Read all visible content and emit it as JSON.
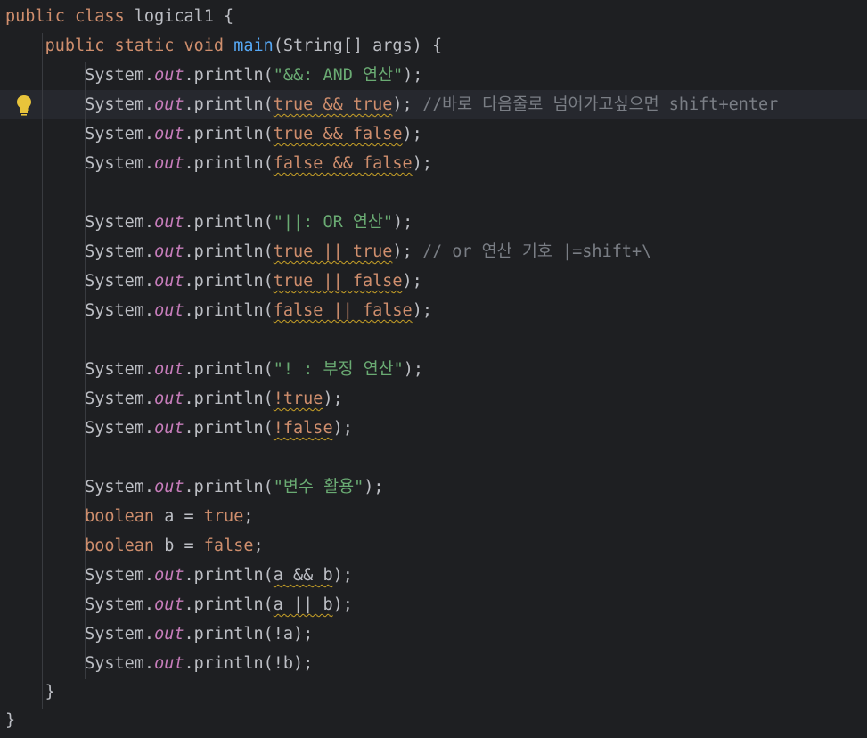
{
  "editor": {
    "theme": {
      "background": "#1e1f22",
      "current_line": "#26282e",
      "keyword": "#cf8e6d",
      "method_decl": "#56a8f5",
      "static_field": "#c77dbb",
      "string": "#6aab73",
      "comment": "#7a7e85",
      "default": "#bcbec4",
      "warning_underline": "#c9a227"
    },
    "code": {
      "class_decl": {
        "kw": "public class",
        "name": "logical1",
        "brace": "{"
      },
      "method_decl": {
        "kw": "public static void",
        "name": "main",
        "params": "(String[] args) {"
      },
      "sys": "System.",
      "out": "out",
      "println": ".println(",
      "close": ");",
      "kw_boolean": "boolean",
      "lines": {
        "s1": "\"&&: AND 연산\"",
        "t1": "true && true",
        "c1": "//바로 다음줄로 넘어가고싶으면 shift+enter",
        "t2": "true && false",
        "t3": "false && false",
        "s2": "\"||: OR 연산\"",
        "t4": "true || true",
        "c2": "// or 연산 기호 |=shift+\\",
        "t5": "true || false",
        "t6": "false || false",
        "s3": "\"! : 부정 연산\"",
        "t7": "!true",
        "t8": "!false",
        "s4": "\"변수 활용\"",
        "var_a": "a = ",
        "val_true": "true",
        "var_b": "b = ",
        "val_false": "false",
        "semi": ";",
        "t9": "a && b",
        "t10": "a || b",
        "t11": "!a",
        "t12": "!b"
      },
      "method_close": "}",
      "class_close": "}"
    }
  }
}
